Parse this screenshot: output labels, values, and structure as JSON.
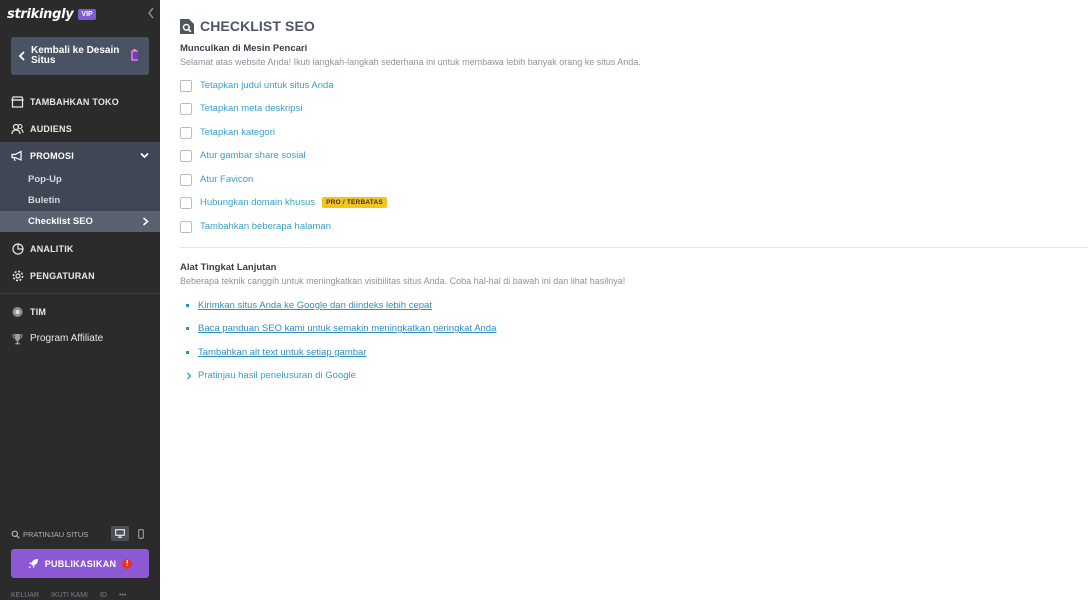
{
  "sidebar": {
    "brand": "strikingly",
    "vip": "VIP",
    "back_label": "Kembali ke Desain Situs",
    "nav": [
      {
        "label": "TAMBAHKAN TOKO",
        "icon": "store-icon"
      },
      {
        "label": "AUDIENS",
        "icon": "users-icon"
      },
      {
        "label": "PROMOSI",
        "icon": "megaphone-icon"
      }
    ],
    "sub_items": [
      "Pop-Up",
      "Buletin",
      "Checklist SEO"
    ],
    "nav_after": [
      {
        "label": "ANALITIK",
        "icon": "chart-pie-icon"
      },
      {
        "label": "PENGATURAN",
        "icon": "gear-icon"
      },
      {
        "label": "TIM",
        "icon": "team-icon"
      },
      {
        "label": "Program Affiliate",
        "icon": "trophy-icon"
      }
    ],
    "preview_label": "PRATINJAU SITUS",
    "publish_label": "PUBLIKASIKAN",
    "alert": "!",
    "footer": [
      "KELUAR",
      "IKUTI KAMI",
      "ID",
      "•••"
    ]
  },
  "main": {
    "title": "CHECKLIST SEO",
    "section1_title": "Munculkan di Mesin Pencari",
    "section1_desc": "Selamat atas website Anda! Ikuti langkah-langkah sederhana ini untuk membawa lebih banyak orang ke situs Anda.",
    "checklist": [
      "Tetapkan judul untuk situs Anda",
      "Tetapkan meta deskripsi",
      "Tetapkan kategori",
      "Atur gambar share sosial",
      "Atur Favicon",
      "Hubungkan domain khusus",
      "Tambahkan beberapa halaman"
    ],
    "pro_badge": "PRO / TERBATAS",
    "section2_title": "Alat Tingkat Lanjutan",
    "section2_desc": "Beberapa teknik canggih untuk meningkatkan visibilitas situs Anda. Coba hal-hal di bawah ini dan lihat hasilnya!",
    "advanced_links": [
      "Kirimkan situs Anda ke Google dan diindeks lebih cepat",
      "Baca panduan SEO kami untuk semakin meningkatkan peringkat Anda",
      "Tambahkan alt text untuk setiap gambar"
    ],
    "preview_google": "Pratinjau hasil penelusuran di Google"
  },
  "colors": {
    "sidebar_bg": "#2b2b2b",
    "accent_purple": "#8d58d6",
    "link_blue": "#3aa0c8",
    "pro_yellow": "#f3c420"
  }
}
